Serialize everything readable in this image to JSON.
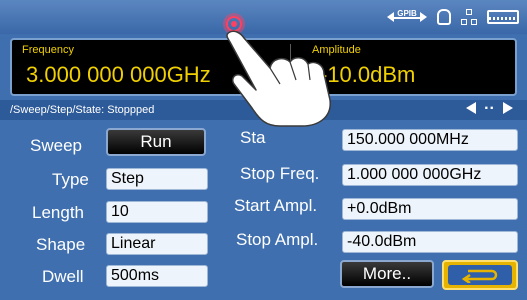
{
  "status_icons": {
    "gpib_label": "GPIB",
    "icons": [
      "gpib-icon",
      "lock-icon",
      "network-icon",
      "keyboard-icon"
    ]
  },
  "readout": {
    "frequency_label": "Frequency",
    "frequency_value": "3.000 000 000GHz",
    "amplitude_label": "Amplitude",
    "amplitude_value": "-10.0dBm"
  },
  "breadcrumb": {
    "path": "/Sweep/Step/State: Stoppped",
    "page_indicator": ".."
  },
  "left_panel": {
    "sweep_label": "Sweep",
    "run_button": "Run",
    "type_label": "Type",
    "type_value": "Step",
    "length_label": "Length",
    "length_value": "10",
    "shape_label": "Shape",
    "shape_value": "Linear",
    "dwell_label": "Dwell",
    "dwell_value": "500ms"
  },
  "right_panel": {
    "start_freq_label": "Sta",
    "start_freq_value": "150.000 000MHz",
    "stop_freq_label": "Stop Freq.",
    "stop_freq_value": "1.000 000 000GHz",
    "start_ampl_label": "Start Ampl.",
    "start_ampl_value": "+0.0dBm",
    "stop_ampl_label": "Stop Ampl.",
    "stop_ampl_value": "-40.0dBm"
  },
  "buttons": {
    "more": "More.."
  },
  "colors": {
    "background": "#3f6fae",
    "readout_text": "#f0d000",
    "return_button": "#e6b400",
    "cursor": "#ff4060"
  }
}
